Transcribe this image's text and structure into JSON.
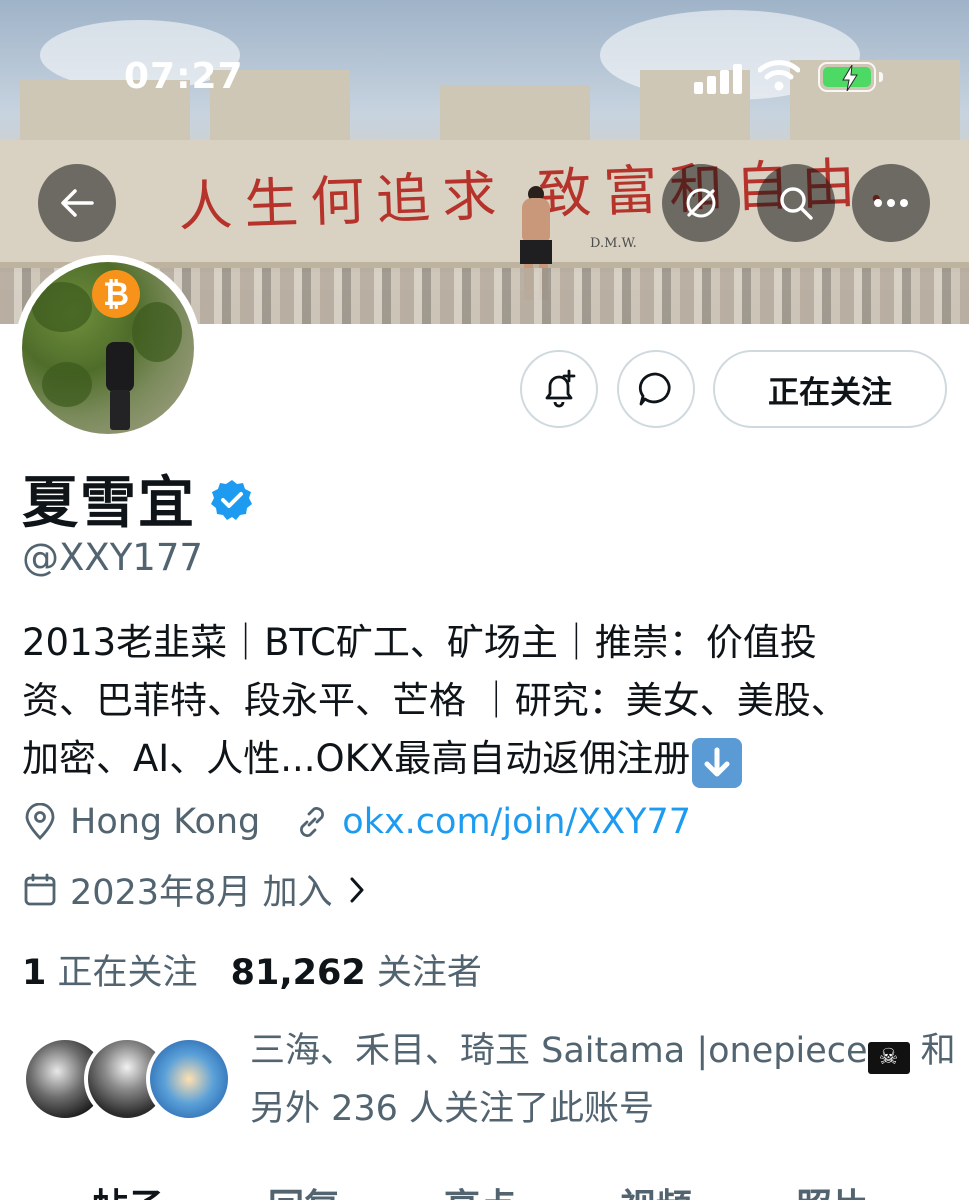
{
  "status_bar": {
    "time": "07:27"
  },
  "banner": {
    "graffiti_text": "人生何追求 致富和自由.",
    "graffiti_signature": "D.M.W."
  },
  "header_buttons": {
    "back": "back-arrow-icon",
    "grok": "grok-icon",
    "search": "search-icon",
    "more": "more-icon"
  },
  "profile": {
    "display_name": "夏雪宜",
    "verified": true,
    "handle": "@XXY177",
    "follow_button_label": "正在关注",
    "bio_lines": [
      "2013老韭菜｜BTC矿工、矿场主｜推崇：价值投",
      "资、巴菲特、段永平、芒格 ｜研究：美女、美股、",
      "加密、AI、人性...OKX最高自动返佣注册"
    ],
    "location": "Hong Kong",
    "website": "okx.com/join/XXY77",
    "joined": "2023年8月 加入",
    "following_count": "1",
    "following_label": "正在关注",
    "followers_count": "81,262",
    "followers_label": "关注者"
  },
  "followed_by": {
    "line1": "三海、禾目、琦玉 Saitama |onepiece",
    "line1_suffix": " 和",
    "line2": "另外 236 人关注了此账号"
  },
  "tabs": [
    "帖子",
    "回复",
    "亮点",
    "视频",
    "照片"
  ],
  "colors": {
    "accent": "#1d9bf0",
    "text_primary": "#0f1419",
    "text_secondary": "#536471",
    "border": "#cfd9de",
    "btc_orange": "#f7931a"
  }
}
